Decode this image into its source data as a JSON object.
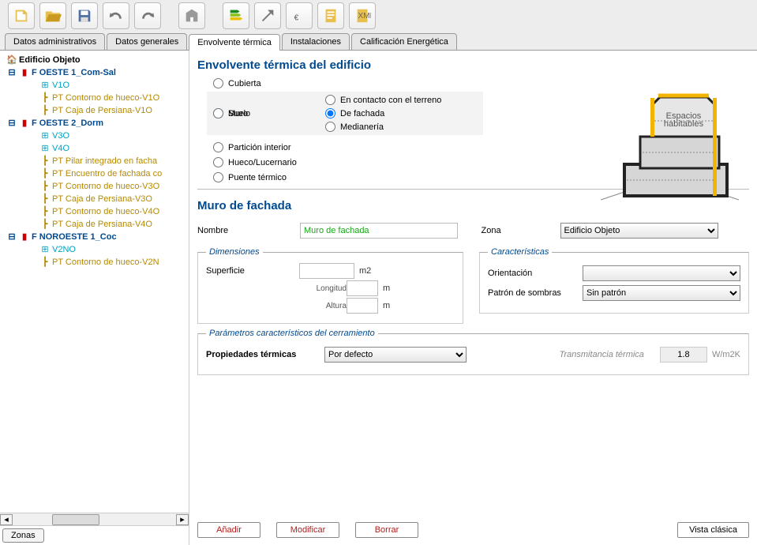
{
  "toolbar": {
    "new": "new",
    "open": "open",
    "save": "save",
    "undo": "undo",
    "redo": "redo",
    "bldg": "building",
    "energy": "energy",
    "export": "export",
    "euro": "euro",
    "report": "report",
    "xml": "xml"
  },
  "tabs": {
    "admin": "Datos administrativos",
    "general": "Datos generales",
    "envelope": "Envolvente térmica",
    "install": "Instalaciones",
    "rating": "Calificación Energética"
  },
  "tree": {
    "root": "Edificio Objeto",
    "f1": "F OESTE 1_Com-Sal",
    "f1_v": "V1O",
    "f1_pt1": "PT Contorno de hueco-V1O",
    "f1_pt2": "PT Caja de Persiana-V1O",
    "f2": "F OESTE 2_Dorm",
    "f2_v1": "V3O",
    "f2_v2": "V4O",
    "f2_pt1": "PT Pilar integrado en facha",
    "f2_pt2": "PT Encuentro de fachada co",
    "f2_pt3": "PT Contorno de hueco-V3O",
    "f2_pt4": "PT Caja de Persiana-V3O",
    "f2_pt5": "PT Contorno de hueco-V4O",
    "f2_pt6": "PT Caja de Persiana-V4O",
    "f3": "F NOROESTE 1_Coc",
    "f3_v": "V2NO",
    "f3_pt": "PT Contorno de hueco-V2N"
  },
  "sidebar": {
    "zones_btn": "Zonas"
  },
  "section1": {
    "title": "Envolvente térmica del edificio",
    "cover": "Cubierta",
    "wall": "Muro",
    "floor": "Suelo",
    "partition": "Partición interior",
    "hole": "Hueco/Lucernario",
    "bridge": "Puente térmico",
    "sub_ground": "En contacto con el terreno",
    "sub_facade": "De fachada",
    "sub_median": "Medianería"
  },
  "diagram": {
    "label": "Espacios\nhabitables"
  },
  "section2": {
    "title": "Muro de fachada",
    "name_lbl": "Nombre",
    "name_val": "Muro de fachada",
    "zone_lbl": "Zona",
    "zone_val": "Edificio Objeto",
    "dim_legend": "Dimensiones",
    "surface": "Superficie",
    "surface_unit": "m2",
    "length": "Longitud",
    "height": "Altura",
    "m": "m",
    "char_legend": "Características",
    "orient": "Orientación",
    "shadow": "Patrón de sombras",
    "shadow_val": "Sin patrón",
    "params_legend": "Parámetros característicos del cerramiento",
    "therm_prop": "Propiedades térmicas",
    "therm_val": "Por defecto",
    "trans_lbl": "Transmitancia térmica",
    "trans_val": "1.8",
    "trans_unit": "W/m2K"
  },
  "buttons": {
    "add": "Añadir",
    "modify": "Modificar",
    "delete": "Borrar",
    "classic": "Vista clásica"
  }
}
